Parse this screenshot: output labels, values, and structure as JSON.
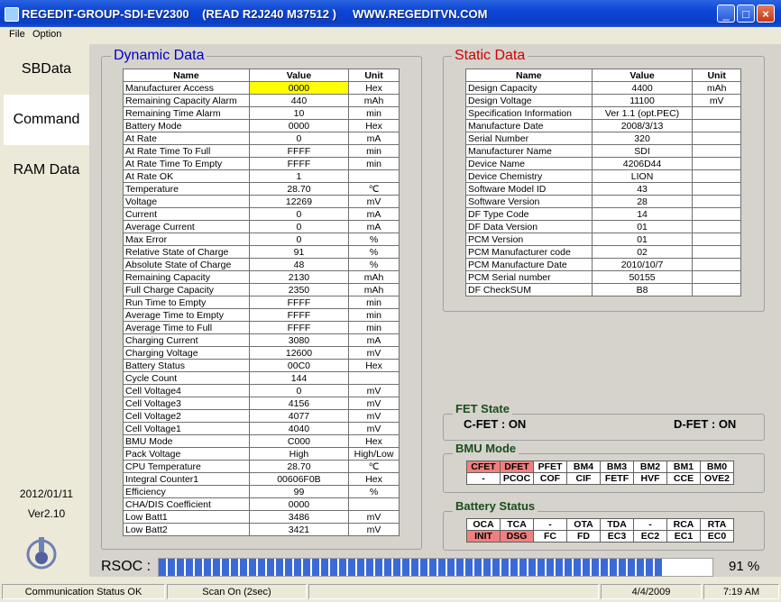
{
  "window": {
    "title": "REGEDIT-GROUP-SDI-EV2300    (READ R2J240 M37512 )     WWW.REGEDITVN.COM"
  },
  "menu": [
    "File",
    "Option"
  ],
  "sidebar": {
    "tabs": [
      "SBData",
      "Command",
      "RAM Data"
    ],
    "date": "2012/01/11",
    "version": "Ver2.10"
  },
  "dynamic": {
    "title": "Dynamic Data",
    "headers": [
      "Name",
      "Value",
      "Unit"
    ],
    "rows": [
      [
        "Manufacturer Access",
        "0000",
        "Hex"
      ],
      [
        "Remaining Capacity Alarm",
        "440",
        "mAh"
      ],
      [
        "Remaining Time Alarm",
        "10",
        "min"
      ],
      [
        "Battery Mode",
        "0000",
        "Hex"
      ],
      [
        "At Rate",
        "0",
        "mA"
      ],
      [
        "At Rate Time To Full",
        "FFFF",
        "min"
      ],
      [
        "At Rate Time To Empty",
        "FFFF",
        "min"
      ],
      [
        "At Rate OK",
        "1",
        ""
      ],
      [
        "Temperature",
        "28.70",
        "℃"
      ],
      [
        "Voltage",
        "12269",
        "mV"
      ],
      [
        "Current",
        "0",
        "mA"
      ],
      [
        "Average Current",
        "0",
        "mA"
      ],
      [
        "Max Error",
        "0",
        "%"
      ],
      [
        "Relative State of Charge",
        "91",
        "%"
      ],
      [
        "Absolute State of Charge",
        "48",
        "%"
      ],
      [
        "Remaining Capacity",
        "2130",
        "mAh"
      ],
      [
        "Full Charge Capacity",
        "2350",
        "mAh"
      ],
      [
        "Run Time to Empty",
        "FFFF",
        "min"
      ],
      [
        "Average Time to Empty",
        "FFFF",
        "min"
      ],
      [
        "Average Time to Full",
        "FFFF",
        "min"
      ],
      [
        "Charging Current",
        "3080",
        "mA"
      ],
      [
        "Charging Voltage",
        "12600",
        "mV"
      ],
      [
        "Battery Status",
        "00C0",
        "Hex"
      ],
      [
        "Cycle Count",
        "144",
        ""
      ],
      [
        "Cell Voltage4",
        "0",
        "mV"
      ],
      [
        "Cell Voltage3",
        "4156",
        "mV"
      ],
      [
        "Cell Voltage2",
        "4077",
        "mV"
      ],
      [
        "Cell Voltage1",
        "4040",
        "mV"
      ],
      [
        "BMU Mode",
        "C000",
        "Hex"
      ],
      [
        "Pack Voltage",
        "High",
        "High/Low"
      ],
      [
        "CPU Temperature",
        "28.70",
        "℃"
      ],
      [
        "Integral Counter1",
        "00606F0B",
        "Hex"
      ],
      [
        "Efficiency",
        "99",
        "%"
      ],
      [
        "CHA/DIS Coefficient",
        "0000",
        ""
      ],
      [
        "Low Batt1",
        "3486",
        "mV"
      ],
      [
        "Low Batt2",
        "3421",
        "mV"
      ]
    ]
  },
  "static": {
    "title": "Static Data",
    "headers": [
      "Name",
      "Value",
      "Unit"
    ],
    "rows": [
      [
        "Design Capacity",
        "4400",
        "mAh"
      ],
      [
        "Design Voltage",
        "11100",
        "mV"
      ],
      [
        "Specification Information",
        "Ver 1.1 (opt.PEC)",
        ""
      ],
      [
        "Manufacture Date",
        "2008/3/13",
        ""
      ],
      [
        "Serial Number",
        "320",
        ""
      ],
      [
        "Manufacturer Name",
        "SDI",
        ""
      ],
      [
        "Device Name",
        "4206D44",
        ""
      ],
      [
        "Device Chemistry",
        "LION",
        ""
      ],
      [
        "Software Model ID",
        "43",
        ""
      ],
      [
        "Software Version",
        "28",
        ""
      ],
      [
        "DF Type Code",
        "14",
        ""
      ],
      [
        "DF Data Version",
        "01",
        ""
      ],
      [
        "PCM Version",
        "01",
        ""
      ],
      [
        "PCM Manufacturer code",
        "02",
        ""
      ],
      [
        "PCM Manufacture Date",
        "2010/10/7",
        ""
      ],
      [
        "PCM Serial number",
        "50155",
        ""
      ],
      [
        "DF CheckSUM",
        "B8",
        ""
      ]
    ]
  },
  "fet": {
    "title": "FET State",
    "cfet": "C-FET : ON",
    "dfet": "D-FET : ON"
  },
  "bmu": {
    "title": "BMU Mode",
    "row1": [
      {
        "t": "CFET",
        "on": true
      },
      {
        "t": "DFET",
        "on": true
      },
      {
        "t": "PFET"
      },
      {
        "t": "BM4"
      },
      {
        "t": "BM3"
      },
      {
        "t": "BM2"
      },
      {
        "t": "BM1"
      },
      {
        "t": "BM0"
      }
    ],
    "row2": [
      {
        "t": "-"
      },
      {
        "t": "PCOC"
      },
      {
        "t": "COF"
      },
      {
        "t": "CIF"
      },
      {
        "t": "FETF"
      },
      {
        "t": "HVF"
      },
      {
        "t": "CCE"
      },
      {
        "t": "OVE2"
      }
    ]
  },
  "battery_status": {
    "title": "Battery Status",
    "row1": [
      {
        "t": "OCA"
      },
      {
        "t": "TCA"
      },
      {
        "t": "-"
      },
      {
        "t": "OTA"
      },
      {
        "t": "TDA"
      },
      {
        "t": "-"
      },
      {
        "t": "RCA"
      },
      {
        "t": "RTA"
      }
    ],
    "row2": [
      {
        "t": "INIT",
        "on": true
      },
      {
        "t": "DSG",
        "on": true
      },
      {
        "t": "FC"
      },
      {
        "t": "FD"
      },
      {
        "t": "EC3"
      },
      {
        "t": "EC2"
      },
      {
        "t": "EC1"
      },
      {
        "t": "EC0"
      }
    ]
  },
  "rsoc": {
    "label": "RSOC :",
    "percent": 91,
    "percent_text": "91 %"
  },
  "status": {
    "comm": "Communication Status OK",
    "scan": "Scan On (2sec)",
    "date": "4/4/2009",
    "time": "7:19 AM"
  },
  "colors": {
    "highlight": "#ffff00",
    "bit_on": "#f08080",
    "progress": "#3b6ad8"
  }
}
